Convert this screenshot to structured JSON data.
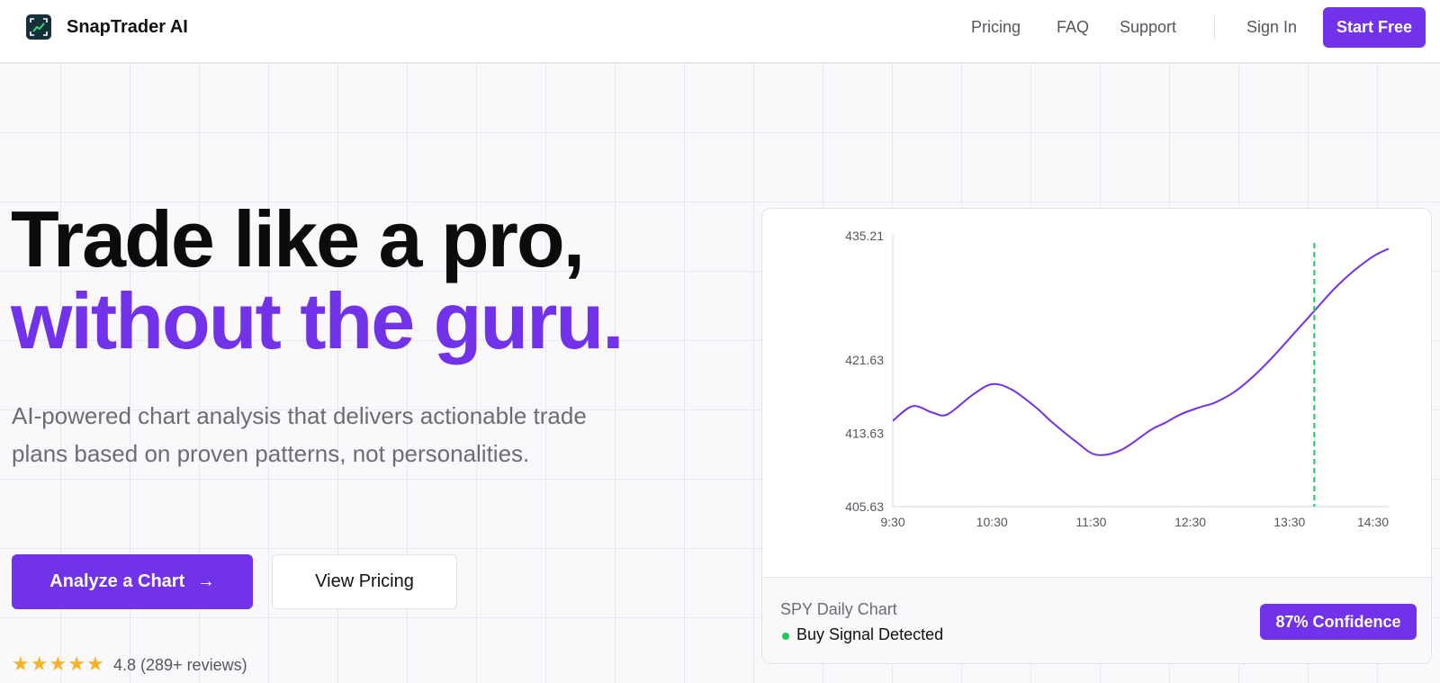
{
  "nav": {
    "brand": "SnapTrader AI",
    "links": [
      "Pricing",
      "FAQ",
      "Support"
    ],
    "sign_in": "Sign In",
    "start_free": "Start Free"
  },
  "hero": {
    "headline_line1": "Trade like a pro,",
    "headline_line2": "without the guru.",
    "subheadline": "AI-powered chart analysis that delivers actionable trade plans based on proven patterns, not personalities.",
    "primary_cta": "Analyze a Chart",
    "primary_cta_icon": "arrow-right-icon",
    "secondary_cta": "View Pricing",
    "rating_stars": 5,
    "rating_text": "4.8 (289+ reviews)"
  },
  "colors": {
    "accent": "#7232ea",
    "signal": "#23c55e",
    "star": "#f5b325"
  },
  "chart_card": {
    "title": "SPY Daily Chart",
    "signal_text": "Buy Signal Detected",
    "confidence_label": "87% Confidence"
  },
  "chart_data": {
    "type": "line",
    "x": [
      0,
      0.2,
      0.4,
      0.55,
      0.8,
      1.0,
      1.2,
      1.45,
      1.6,
      1.85,
      2.05,
      2.3,
      2.6,
      2.75,
      2.9,
      3.1,
      3.25,
      3.45,
      3.65,
      3.85,
      4.05,
      4.25,
      4.45,
      4.65,
      4.85,
      5.0
    ],
    "x_tick_labels": [
      "9:30",
      "10:30",
      "11:30",
      "12:30",
      "13:30",
      "14:30"
    ],
    "x_ticks": [
      0,
      1,
      2,
      3,
      4,
      5
    ],
    "values": [
      415.0,
      416.6,
      415.9,
      415.7,
      417.8,
      419.0,
      418.4,
      416.4,
      414.9,
      412.7,
      411.3,
      411.8,
      414.0,
      414.8,
      415.7,
      416.5,
      417.0,
      418.2,
      420.0,
      422.2,
      424.6,
      427.0,
      429.4,
      431.4,
      433.0,
      433.8
    ],
    "y_ticks": [
      405.63,
      413.63,
      421.63,
      435.21
    ],
    "ylim": [
      405.63,
      435.21
    ],
    "xlim": [
      0,
      5
    ],
    "marker_x": 4.25,
    "marker_style": "dashed-vertical",
    "grid": false,
    "line_color": "#7232ea",
    "marker_color": "#23c55e"
  }
}
